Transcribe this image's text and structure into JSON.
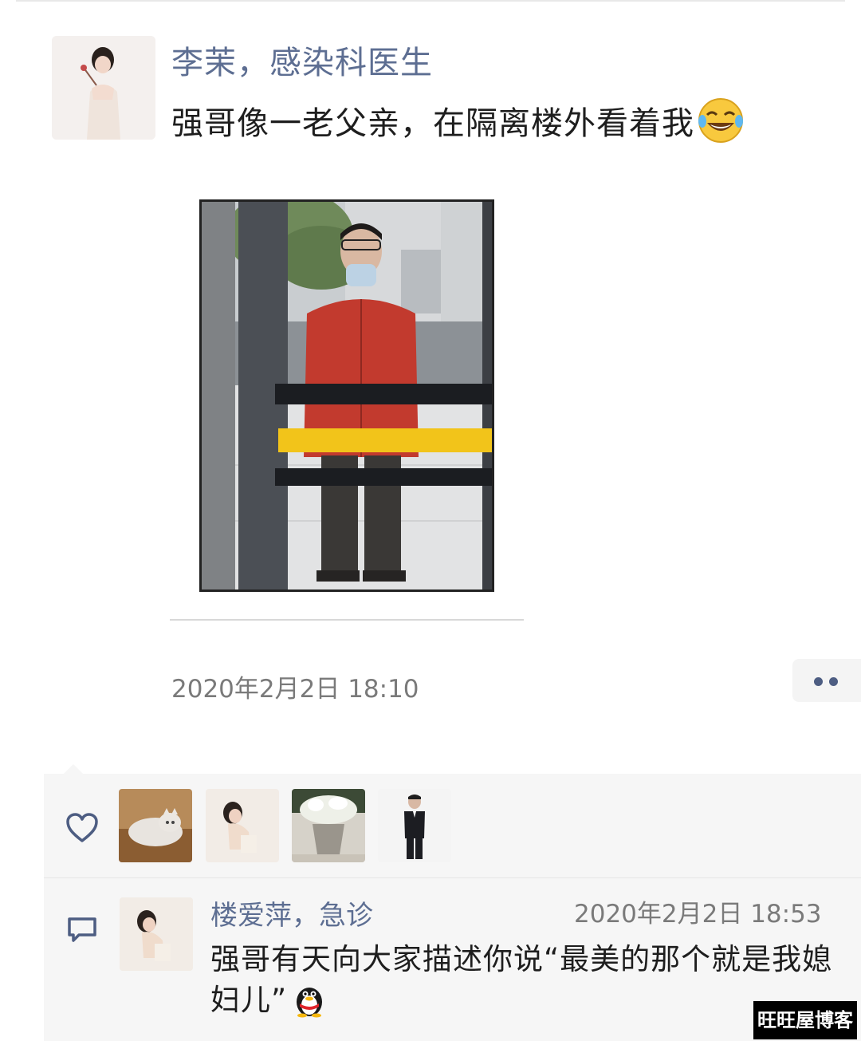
{
  "post": {
    "author": "李茉，感染科医生",
    "text": "强哥像一老父亲，在隔离楼外看着我",
    "emoji": "laugh-cry-emoji",
    "timestamp": "2020年2月2日 18:10"
  },
  "likes": {
    "icon": "heart-icon",
    "avatars": [
      "cat-avatar",
      "girl-sitting-avatar",
      "flower-pot-avatar",
      "man-suit-avatar"
    ]
  },
  "comment": {
    "icon": "comment-icon",
    "author": "楼爱萍，急诊",
    "time": "2020年2月2日 18:53",
    "text": "强哥有天向大家描述你说“最美的那个就是我媳妇儿”",
    "emoji": "qq-penguin-emoji"
  },
  "watermark": "旺旺屋博客",
  "colors": {
    "name_link": "#5d6e92",
    "text": "#1e1e1e",
    "meta": "#7a7a7a",
    "panel_bg": "#f6f6f6"
  }
}
